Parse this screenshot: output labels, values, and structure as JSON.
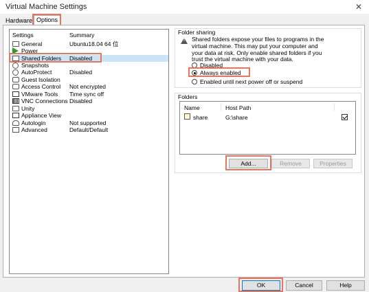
{
  "window": {
    "title": "Virtual Machine Settings",
    "close_glyph": "✕"
  },
  "tabs": [
    {
      "label": "Hardware"
    },
    {
      "label": "Options"
    }
  ],
  "settings_list": {
    "header_setting": "Settings",
    "header_summary": "Summary",
    "items": [
      {
        "name": "General",
        "summary": "Ubuntu18.04 64 位",
        "icon": "general-icon"
      },
      {
        "name": "Power",
        "summary": "",
        "icon": "power-icon"
      },
      {
        "name": "Shared Folders",
        "summary": "Disabled",
        "icon": "shared-folders-icon"
      },
      {
        "name": "Snapshots",
        "summary": "",
        "icon": "snapshots-icon"
      },
      {
        "name": "AutoProtect",
        "summary": "Disabled",
        "icon": "autoprotect-icon"
      },
      {
        "name": "Guest Isolation",
        "summary": "",
        "icon": "guest-isolation-icon"
      },
      {
        "name": "Access Control",
        "summary": "Not encrypted",
        "icon": "access-control-icon"
      },
      {
        "name": "VMware Tools",
        "summary": "Time sync off",
        "icon": "vmware-tools-icon"
      },
      {
        "name": "VNC Connections",
        "summary": "Disabled",
        "icon": "vnc-icon"
      },
      {
        "name": "Unity",
        "summary": "",
        "icon": "unity-icon"
      },
      {
        "name": "Appliance View",
        "summary": "",
        "icon": "appliance-view-icon"
      },
      {
        "name": "Autologin",
        "summary": "Not supported",
        "icon": "autologin-icon"
      },
      {
        "name": "Advanced",
        "summary": "Default/Default",
        "icon": "advanced-icon"
      }
    ]
  },
  "folder_sharing": {
    "title": "Folder sharing",
    "warning": "Shared folders expose your files to programs in the virtual machine. This may put your computer and your data at risk. Only enable shared folders if you trust the virtual machine with your data.",
    "options": [
      {
        "label": "Disabled",
        "selected": false
      },
      {
        "label": "Always enabled",
        "selected": true
      },
      {
        "label": "Enabled until next power off or suspend",
        "selected": false
      }
    ]
  },
  "folders": {
    "title": "Folders",
    "col_name": "Name",
    "col_path": "Host Path",
    "rows": [
      {
        "name": "share",
        "path": "G:\\share",
        "enabled": true
      }
    ],
    "add_label": "Add...",
    "remove_label": "Remove",
    "properties_label": "Properties"
  },
  "footer": {
    "ok_label": "OK",
    "cancel_label": "Cancel",
    "help_label": "Help"
  },
  "highlight_color": "#e8745a"
}
